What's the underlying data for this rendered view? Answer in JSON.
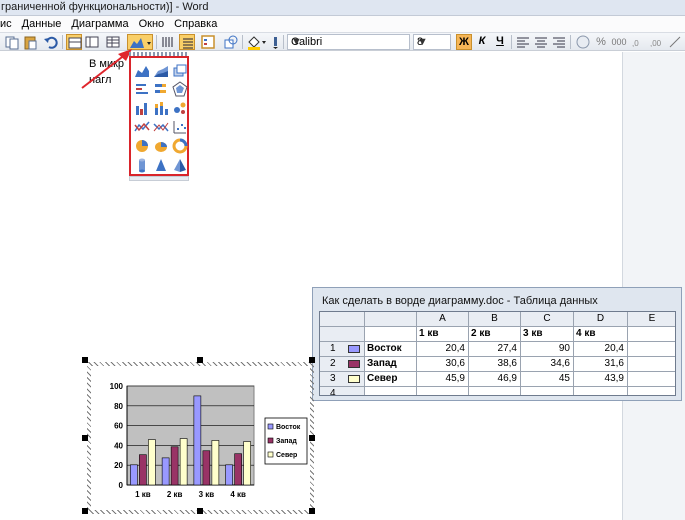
{
  "window": {
    "title": "граниченной функциональности)] - Word"
  },
  "menu": {
    "items": [
      "ис",
      "Данные",
      "Диаграмма",
      "Окно",
      "Справка"
    ]
  },
  "toolbar": {
    "font_name": "Calibri",
    "font_size": "8",
    "bold": "Ж",
    "italic": "К",
    "underline": "Ч"
  },
  "document": {
    "line1": "В микр",
    "line2": "нагл"
  },
  "datasheet": {
    "title": "Как сделать в ворде диаграмму.doc - Таблица данных",
    "columns": [
      "A",
      "B",
      "C",
      "D",
      "E"
    ],
    "subheaders": [
      "1 кв",
      "2 кв",
      "3 кв",
      "4 кв",
      ""
    ],
    "rows": [
      {
        "num": "1",
        "label": "Восток",
        "values": [
          "20,4",
          "27,4",
          "90",
          "20,4"
        ]
      },
      {
        "num": "2",
        "label": "Запад",
        "values": [
          "30,6",
          "38,6",
          "34,6",
          "31,6"
        ]
      },
      {
        "num": "3",
        "label": "Север",
        "values": [
          "45,9",
          "46,9",
          "45",
          "43,9"
        ]
      },
      {
        "num": "4",
        "label": "",
        "values": [
          "",
          "",
          "",
          ""
        ]
      }
    ]
  },
  "chart_data": {
    "type": "bar",
    "categories": [
      "1 кв",
      "2 кв",
      "3 кв",
      "4 кв"
    ],
    "series": [
      {
        "name": "Восток",
        "values": [
          20.4,
          27.4,
          90,
          20.4
        ]
      },
      {
        "name": "Запад",
        "values": [
          30.6,
          38.6,
          34.6,
          31.6
        ]
      },
      {
        "name": "Север",
        "values": [
          45.9,
          46.9,
          45,
          43.9
        ]
      }
    ],
    "ylim": [
      0,
      100
    ],
    "yticks": [
      "0",
      "20",
      "40",
      "60",
      "80",
      "100"
    ],
    "grid": true,
    "legend": "right",
    "colors": [
      "#9999ff",
      "#993366",
      "#ffffcc"
    ],
    "plot_bg": "#c0c0c0"
  }
}
